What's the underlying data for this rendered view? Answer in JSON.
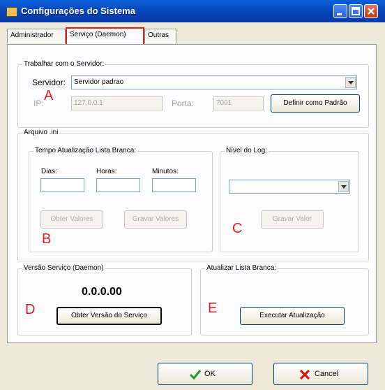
{
  "window": {
    "title": "Configurações do Sistema"
  },
  "tabs": [
    "Administrador",
    "Serviço (Daemon)",
    "Outras"
  ],
  "server_group": {
    "legend": "Trabalhar com o Servidor:",
    "server_label": "Servidor:",
    "server_value": "Servidor padrao",
    "ip_label": "IP:",
    "ip_value": "127.0.0.1",
    "port_label": "Porta:",
    "port_value": "7001",
    "default_button": "Definir como Padrão"
  },
  "ini_group": {
    "legend": "Arquivo .ini",
    "whitelist": {
      "legend": "Tempo Atualização Lista Branca:",
      "days_label": "Dias:",
      "hours_label": "Horas:",
      "minutes_label": "Minutos:",
      "get_button": "Obter Valores",
      "save_button": "Gravar Valores"
    },
    "log": {
      "legend": "Nível do Log:",
      "save_button": "Gravar Valor"
    }
  },
  "version_group": {
    "legend": "Versão Serviço (Daemon)",
    "version": "0.0.0.00",
    "get_button": "Obter Versão do Serviço"
  },
  "update_group": {
    "legend": "Atualizar Lista Branca:",
    "run_button": "Executar Atualização"
  },
  "annotations": {
    "a": "A",
    "b": "B",
    "c": "C",
    "d": "D",
    "e": "E"
  },
  "footer": {
    "ok": "OK",
    "cancel": "Cancel"
  },
  "icons": {
    "ok": "green-check-icon",
    "cancel": "red-x-icon"
  },
  "colors": {
    "title_bar": "#0842b5",
    "annotation": "#e02020"
  }
}
